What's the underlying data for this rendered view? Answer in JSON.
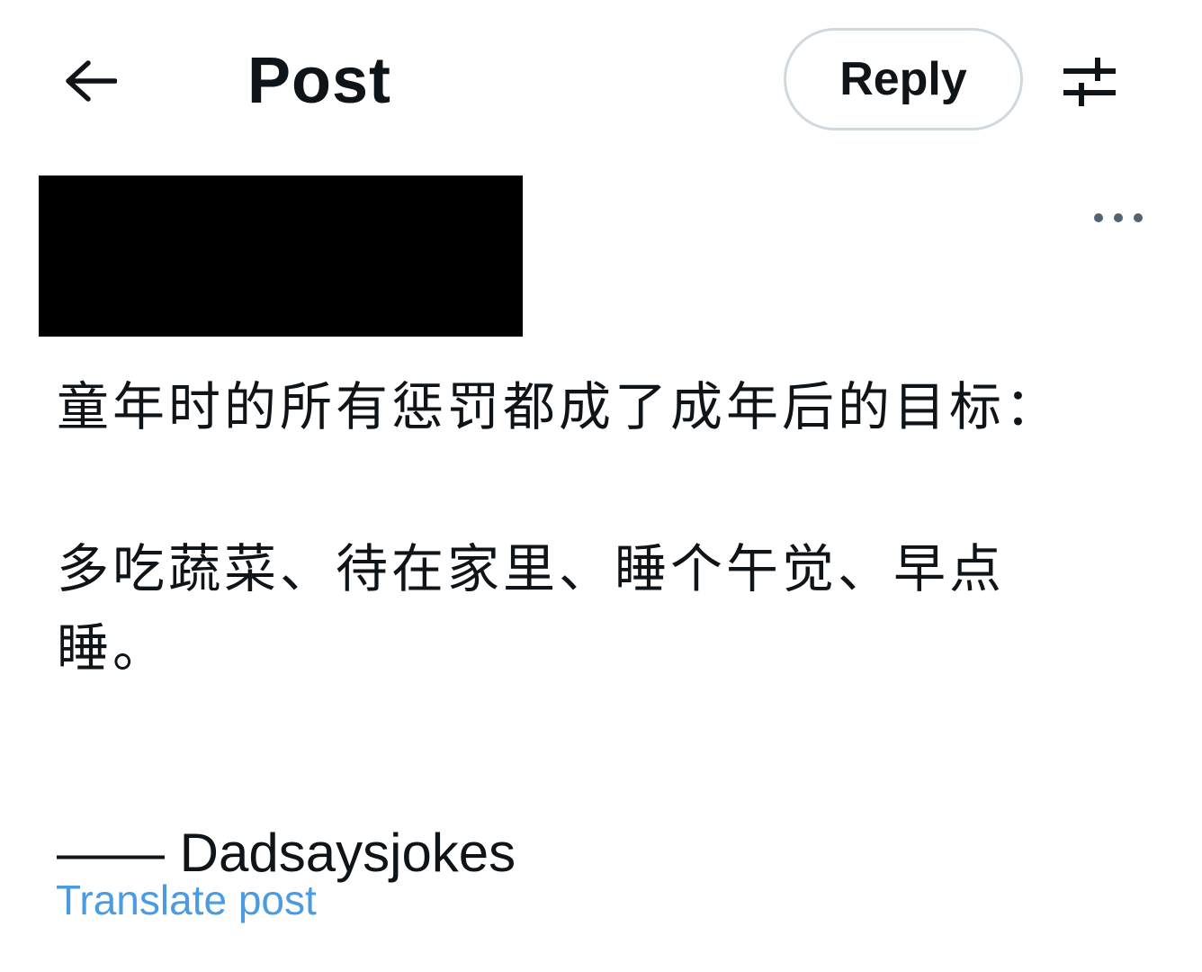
{
  "header": {
    "back_icon": "arrow-left-icon",
    "title": "Post",
    "reply_label": "Reply",
    "filter_icon": "sliders-icon"
  },
  "post": {
    "author_redacted": true,
    "more_icon": "more-horizontal-icon",
    "line1": "童年时的所有惩罚都成了成年后的目标：",
    "line2": "多吃蔬菜、待在家里、睡个午觉、早点睡。",
    "attribution": "—— Dadsaysjokes",
    "translate_label": "Translate post"
  },
  "colors": {
    "text": "#0f1419",
    "link": "#4b9be0",
    "border": "#cfd9de",
    "redaction": "#000000"
  }
}
